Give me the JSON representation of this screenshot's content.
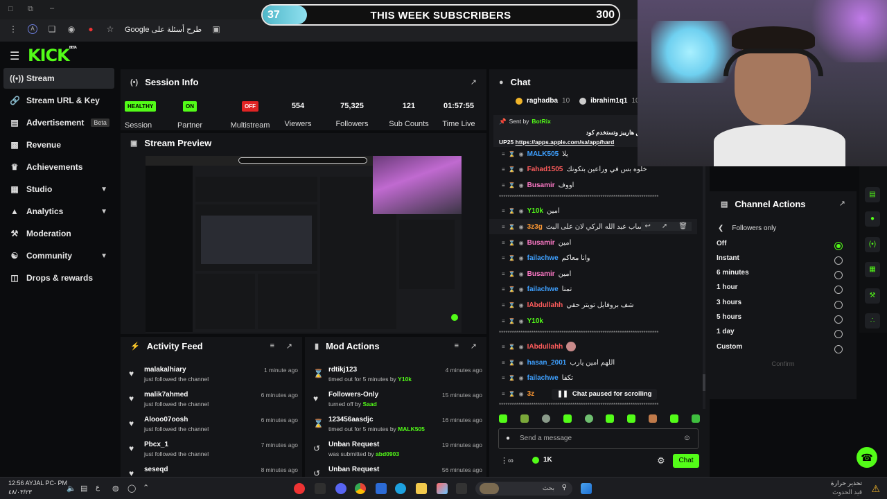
{
  "browser": {
    "address_text": "طرح أسئلة على Google"
  },
  "goal_bar": {
    "current": "37",
    "title": "THIS WEEK SUBSCRIBERS",
    "target": "300",
    "progress_fraction": 0.12
  },
  "sidebar": {
    "items": [
      {
        "label": "Stream",
        "icon": "broadcast-icon",
        "active": true
      },
      {
        "label": "Stream URL & Key",
        "icon": "link-icon"
      },
      {
        "label": "Advertisement",
        "icon": "ad-icon",
        "badge": "Beta"
      },
      {
        "label": "Revenue",
        "icon": "chart-icon"
      },
      {
        "label": "Achievements",
        "icon": "trophy-icon"
      },
      {
        "label": "Studio",
        "icon": "grid-icon",
        "chevron": true
      },
      {
        "label": "Analytics",
        "icon": "analytics-icon",
        "chevron": true
      },
      {
        "label": "Moderation",
        "icon": "wrench-icon"
      },
      {
        "label": "Community",
        "icon": "community-icon",
        "chevron": true
      },
      {
        "label": "Drops & rewards",
        "icon": "gift-icon"
      }
    ]
  },
  "session": {
    "title": "Session Info",
    "stats": [
      {
        "value": "HEALTHY",
        "label": "Session",
        "type": "badge",
        "color": "#53fc18"
      },
      {
        "value": "ON",
        "label": "Partner",
        "type": "badge",
        "color": "#53fc18"
      },
      {
        "value": "OFF",
        "label": "Multistream",
        "type": "badge",
        "color": "#e02424"
      },
      {
        "value": "554",
        "label": "Viewers"
      },
      {
        "value": "75,325",
        "label": "Followers"
      },
      {
        "value": "121",
        "label": "Sub Counts"
      },
      {
        "value": "01:57:55",
        "label": "Time Live"
      }
    ]
  },
  "preview": {
    "title": "Stream Preview"
  },
  "activity": {
    "title": "Activity Feed",
    "items": [
      {
        "name": "malakalhiary",
        "sub": "just followed the channel",
        "time": "1 minute ago"
      },
      {
        "name": "malik7ahmed",
        "sub": "just followed the channel",
        "time": "6 minutes ago"
      },
      {
        "name": "Alooo07oosh",
        "sub": "just followed the channel",
        "time": "6 minutes ago"
      },
      {
        "name": "Pbcx_1",
        "sub": "just followed the channel",
        "time": "7 minutes ago"
      },
      {
        "name": "seseqd",
        "sub": "",
        "time": "8 minutes ago"
      }
    ]
  },
  "mod": {
    "title": "Mod Actions",
    "items": [
      {
        "name": "rdtikj123",
        "sub": "timed out for 5 minutes by",
        "by": "Y10k",
        "time": "4 minutes ago",
        "icon": "hourglass-icon"
      },
      {
        "name": "Followers-Only",
        "sub": "turned off by",
        "by": "Saad",
        "time": "15 minutes ago",
        "icon": "heart-icon"
      },
      {
        "name": "123456aasdjc",
        "sub": "timed out for 5 minutes by",
        "by": "MALK505",
        "time": "16 minutes ago",
        "icon": "hourglass-icon"
      },
      {
        "name": "Unban Request",
        "sub": "was submitted by",
        "by": "abd0903",
        "time": "19 minutes ago",
        "icon": "undo-icon"
      },
      {
        "name": "Unban Request",
        "sub": "",
        "by": "",
        "time": "56 minutes ago",
        "icon": "undo-icon"
      }
    ]
  },
  "chat": {
    "title": "Chat",
    "top_gifters": [
      {
        "name": "raghadba",
        "count": "10"
      },
      {
        "name": "ibrahim1q1",
        "count": "10"
      }
    ],
    "pinned": {
      "sent_by_label": "Sent by",
      "sender": "BotRix",
      "line1": "لاتنسون تحملون تطبيق هارييز وتستخدم كود",
      "line2_prefix": "UP25",
      "line2_link": "https://apps.apple.com/sa/app/hard"
    },
    "messages": [
      {
        "user": "MALK505",
        "level": "42",
        "text": "يلا",
        "color": "#3ea0ff"
      },
      {
        "user": "Fahad1505",
        "level": "23",
        "text": "خلوه بس في وراعين بتكونك",
        "color": "#ff5c5c"
      },
      {
        "user": "Busamir",
        "level": "23",
        "text": "اووف",
        "color": "#ff7ac8"
      },
      {
        "user": "Y10k",
        "level": "",
        "text": "امين",
        "color": "#53fc18"
      },
      {
        "user": "3z3g",
        "level": "10",
        "text": "اسم حساب عبد الله الركي لان على البث",
        "color": "#ff9933"
      },
      {
        "user": "Busamir",
        "level": "23",
        "text": "امين",
        "color": "#ff7ac8"
      },
      {
        "user": "failachwe",
        "level": "24",
        "text": "وانا معاكم",
        "color": "#3ea0ff"
      },
      {
        "user": "Busamir",
        "level": "23",
        "text": "امين",
        "color": "#ff7ac8"
      },
      {
        "user": "failachwe",
        "level": "24",
        "text": "تمنا",
        "color": "#3ea0ff"
      },
      {
        "user": "IAbdullahh",
        "level": "1",
        "text": "شف بروفايل تويتر حقي",
        "color": "#ff5c5c"
      },
      {
        "user": "Y10k",
        "level": "23",
        "text": "",
        "color": "#53fc18"
      },
      {
        "user": "IAbdullahh",
        "level": "1",
        "text": "",
        "color": "#ff5c5c"
      },
      {
        "user": "hasan_2001",
        "level": "",
        "text": "اللهم امين يارب",
        "color": "#3ea0ff"
      },
      {
        "user": "failachwe",
        "level": "24",
        "text": "تكفا",
        "color": "#3ea0ff"
      },
      {
        "user": "3z",
        "level": "",
        "text": "",
        "color": "#ff9933"
      }
    ],
    "paused_text": "Chat paused for scrolling",
    "input_placeholder": "Send a message",
    "viewers_short": "1K",
    "send_label": "Chat"
  },
  "channel_actions": {
    "title": "Channel Actions",
    "back_label": "Followers only",
    "options": [
      {
        "label": "Off",
        "selected": true
      },
      {
        "label": "Instant",
        "selected": false
      },
      {
        "label": "6 minutes",
        "selected": false
      },
      {
        "label": "1 hour",
        "selected": false
      },
      {
        "label": "3 hours",
        "selected": false
      },
      {
        "label": "5 hours",
        "selected": false
      },
      {
        "label": "1 day",
        "selected": false
      },
      {
        "label": "Custom",
        "selected": false
      }
    ],
    "confirm_label": "Confirm"
  },
  "taskbar": {
    "time": "12:56 AYJAL PC- PM",
    "date": "٤٨/٠٣/٢٣",
    "search_placeholder": "بحث",
    "weather_line1": "تحذير حرارة",
    "weather_line2": "قيد الحدوث"
  }
}
